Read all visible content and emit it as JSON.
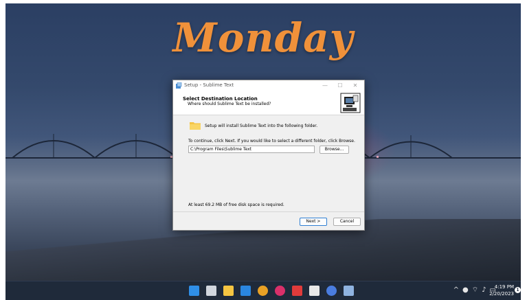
{
  "wallpaper": {
    "text": "Monday"
  },
  "dialog": {
    "window_title": "Setup - Sublime Text",
    "header_title": "Select Destination Location",
    "header_subtitle": "Where should Sublime Text be installed?",
    "intro": "Setup will install Sublime Text into the following folder.",
    "continue_text": "To continue, click Next. If you would like to select a different folder, click Browse.",
    "path_value": "C:\\Program Files\\Sublime Text",
    "browse_label": "Browse...",
    "space_text": "At least 69.2 MB of free disk space is required.",
    "next_label": "Next >",
    "cancel_label": "Cancel",
    "minimize_glyph": "—",
    "maximize_glyph": "☐",
    "close_glyph": "✕"
  },
  "taskbar": {
    "icons": [
      {
        "name": "start-icon",
        "color": "#2f8fe8"
      },
      {
        "name": "task-view-icon",
        "color": "#d0d6de"
      },
      {
        "name": "file-explorer-icon",
        "color": "#f5c542"
      },
      {
        "name": "mail-icon",
        "color": "#2a86e0"
      },
      {
        "name": "chrome-icon",
        "color": "#e9a125"
      },
      {
        "name": "app-icon",
        "color": "#d9306a"
      },
      {
        "name": "wps-icon",
        "color": "#e03b3b"
      },
      {
        "name": "notes-icon",
        "color": "#e8e8e8"
      },
      {
        "name": "messages-icon",
        "color": "#4a7de0"
      },
      {
        "name": "setup-icon",
        "color": "#8fb3e0"
      }
    ],
    "clock_time": "4:19 PM",
    "clock_date": "2/20/2023",
    "notification_count": "1",
    "tray_chevron": "^"
  }
}
